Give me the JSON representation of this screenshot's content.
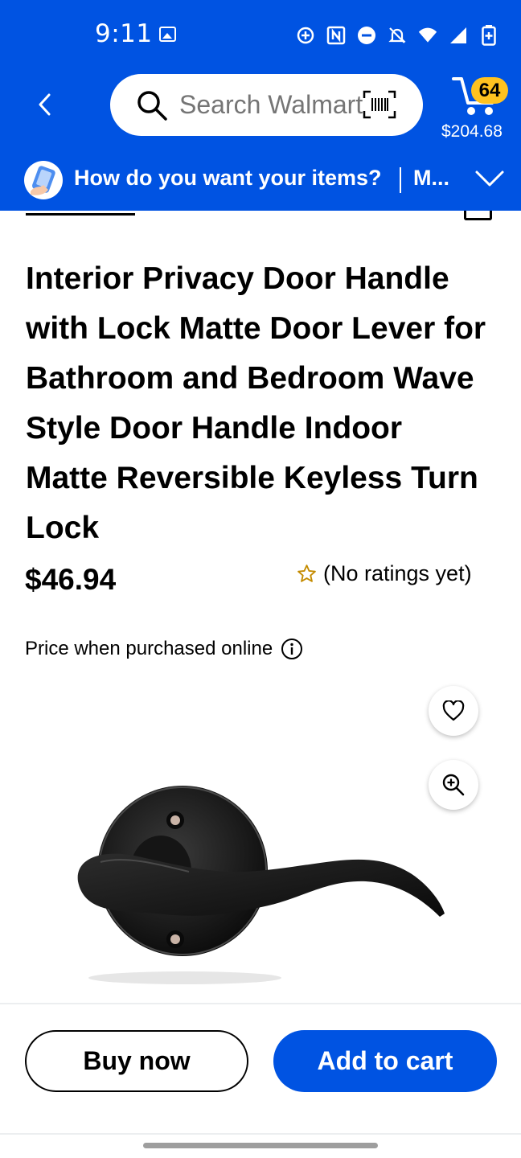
{
  "status_bar": {
    "time": "9:11",
    "icons": [
      "gallery-icon",
      "data-saver-icon",
      "nfc-icon",
      "dnd-icon",
      "mute-icon",
      "wifi-icon",
      "signal-icon",
      "battery-icon"
    ]
  },
  "header": {
    "search_placeholder": "Search Walmart",
    "cart_count": "64",
    "cart_total": "$204.68",
    "fulfillment_prompt": "How do you want your items?",
    "fulfillment_option": "M...",
    "brand_color": "#0053e2",
    "badge_color": "#ffc220"
  },
  "product": {
    "title": "Interior Privacy Door Handle with Lock Matte Door Lever for Bathroom and Bedroom Wave Style Door Handle Indoor Matte Reversible Keyless Turn Lock",
    "price": "$46.94",
    "rating_text": "(No ratings yet)",
    "price_note": "Price when purchased online"
  },
  "actions": {
    "buy_now": "Buy now",
    "add_to_cart": "Add to cart"
  }
}
